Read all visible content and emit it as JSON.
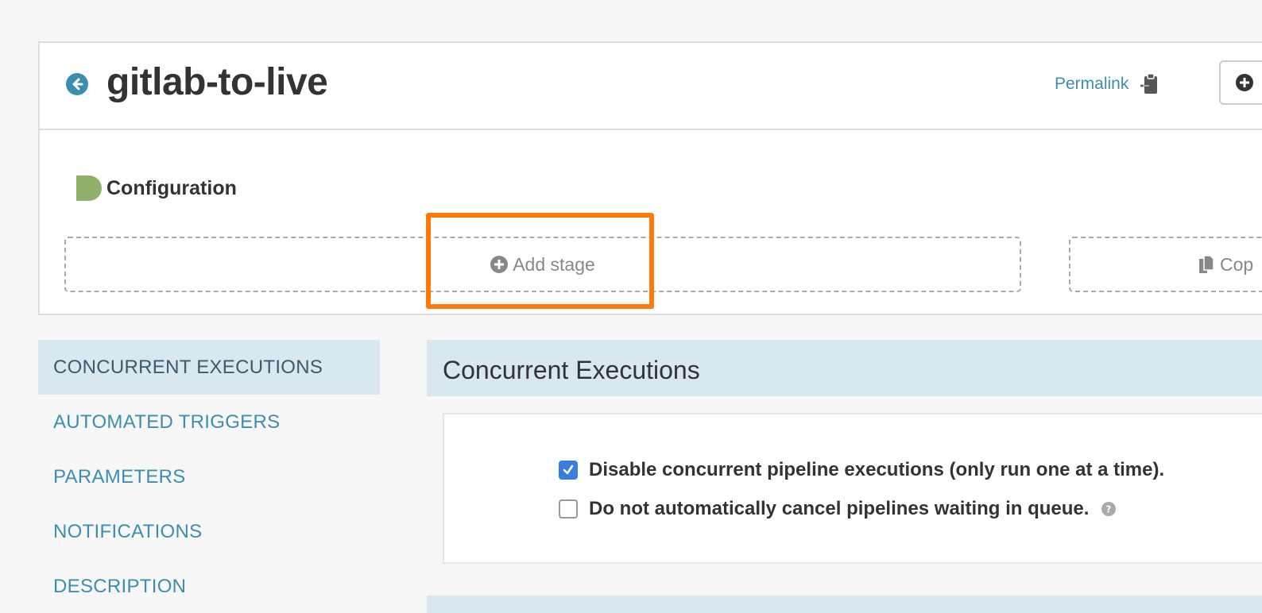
{
  "pipeline": {
    "title": "gitlab-to-live",
    "permalink_label": "Permalink"
  },
  "config": {
    "label": "Configuration",
    "add_stage_label": "Add stage",
    "copy_stage_label": "Cop"
  },
  "nav": {
    "items": [
      {
        "label": "CONCURRENT EXECUTIONS"
      },
      {
        "label": "AUTOMATED TRIGGERS"
      },
      {
        "label": "PARAMETERS"
      },
      {
        "label": "NOTIFICATIONS"
      },
      {
        "label": "DESCRIPTION"
      }
    ],
    "active_index": 0
  },
  "section": {
    "title": "Concurrent Executions",
    "options": [
      {
        "label": "Disable concurrent pipeline executions (only run one at a time).",
        "checked": true
      },
      {
        "label": "Do not automatically cancel pipelines waiting in queue.",
        "checked": false
      }
    ]
  },
  "icons": {
    "back": "arrow-left-circle-icon",
    "clipboard": "clipboard-icon",
    "add": "plus-circle-icon",
    "copy": "copy-icon",
    "help": "question-circle-icon"
  },
  "colors": {
    "accent": "#3a8fb0",
    "nav_active_bg": "#d9e7ee",
    "highlight": "#ff7a0a",
    "checkbox": "#3b7ddd",
    "config_shape": "#8fb06a"
  }
}
